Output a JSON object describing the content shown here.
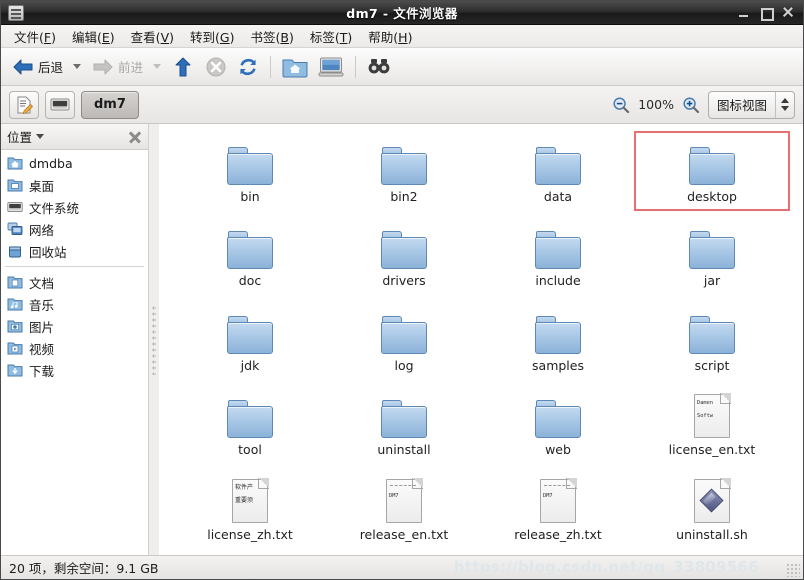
{
  "window": {
    "title": "dm7 - 文件浏览器",
    "app_icon": "file-manager-icon",
    "minimize_label": "最小化",
    "maximize_label": "最大化",
    "close_label": "关闭"
  },
  "menubar": {
    "items": [
      {
        "label": "文件(F)",
        "text": "文件(",
        "mnemonic": "F",
        "tail": ")"
      },
      {
        "label": "编辑(E)",
        "text": "编辑(",
        "mnemonic": "E",
        "tail": ")"
      },
      {
        "label": "查看(V)",
        "text": "查看(",
        "mnemonic": "V",
        "tail": ")"
      },
      {
        "label": "转到(G)",
        "text": "转到(",
        "mnemonic": "G",
        "tail": ")"
      },
      {
        "label": "书签(B)",
        "text": "书签(",
        "mnemonic": "B",
        "tail": ")"
      },
      {
        "label": "标签(T)",
        "text": "标签(",
        "mnemonic": "T",
        "tail": ")"
      },
      {
        "label": "帮助(H)",
        "text": "帮助(",
        "mnemonic": "H",
        "tail": ")"
      }
    ]
  },
  "toolbar": {
    "back_label": "后退",
    "forward_label": "前进",
    "up_label": "向上",
    "stop_label": "停止",
    "reload_label": "重新载入",
    "home_label": "主目录",
    "computer_label": "计算机",
    "search_label": "搜索"
  },
  "locationbar": {
    "edit_location_label": "编辑位置",
    "filesystem_label": "文件系统",
    "path_button": "dm7",
    "zoom_out_label": "缩小",
    "zoom_level": "100%",
    "zoom_in_label": "放大",
    "view_mode": "图标视图"
  },
  "sidebar": {
    "header": "位置",
    "close_label": "关闭侧边栏",
    "groups": [
      {
        "items": [
          {
            "label": "dmdba",
            "icon": "home-folder-icon"
          },
          {
            "label": "桌面",
            "icon": "desktop-folder-icon"
          },
          {
            "label": "文件系统",
            "icon": "drive-icon"
          },
          {
            "label": "网络",
            "icon": "network-icon"
          },
          {
            "label": "回收站",
            "icon": "trash-icon"
          }
        ]
      },
      {
        "items": [
          {
            "label": "文档",
            "icon": "documents-folder-icon"
          },
          {
            "label": "音乐",
            "icon": "music-folder-icon"
          },
          {
            "label": "图片",
            "icon": "pictures-folder-icon"
          },
          {
            "label": "视频",
            "icon": "videos-folder-icon"
          },
          {
            "label": "下载",
            "icon": "downloads-folder-icon"
          }
        ]
      }
    ]
  },
  "files": [
    {
      "name": "bin",
      "type": "folder",
      "selected": false
    },
    {
      "name": "bin2",
      "type": "folder",
      "selected": false
    },
    {
      "name": "data",
      "type": "folder",
      "selected": false
    },
    {
      "name": "desktop",
      "type": "folder",
      "selected": true
    },
    {
      "name": "doc",
      "type": "folder",
      "selected": false
    },
    {
      "name": "drivers",
      "type": "folder",
      "selected": false
    },
    {
      "name": "include",
      "type": "folder",
      "selected": false
    },
    {
      "name": "jar",
      "type": "folder",
      "selected": false
    },
    {
      "name": "jdk",
      "type": "folder",
      "selected": false
    },
    {
      "name": "log",
      "type": "folder",
      "selected": false
    },
    {
      "name": "samples",
      "type": "folder",
      "selected": false
    },
    {
      "name": "script",
      "type": "folder",
      "selected": false
    },
    {
      "name": "tool",
      "type": "folder",
      "selected": false
    },
    {
      "name": "uninstall",
      "type": "folder",
      "selected": false
    },
    {
      "name": "web",
      "type": "folder",
      "selected": false
    },
    {
      "name": "license_en.txt",
      "type": "text",
      "selected": false,
      "preview": [
        "Damen",
        "Softw"
      ]
    },
    {
      "name": "license_zh.txt",
      "type": "text-cjk",
      "selected": false,
      "preview": [
        "软件产",
        "重要须"
      ]
    },
    {
      "name": "release_en.txt",
      "type": "text-dm7",
      "selected": false,
      "preview": [
        "DM7"
      ]
    },
    {
      "name": "release_zh.txt",
      "type": "text-dm7",
      "selected": false,
      "preview": [
        "DM7"
      ]
    },
    {
      "name": "uninstall.sh",
      "type": "script",
      "selected": false,
      "preview": []
    }
  ],
  "statusbar": {
    "text": "20 项，剩余空间：9.1 GB",
    "watermark": "https://blog.csdn.net/qq_33809566"
  }
}
